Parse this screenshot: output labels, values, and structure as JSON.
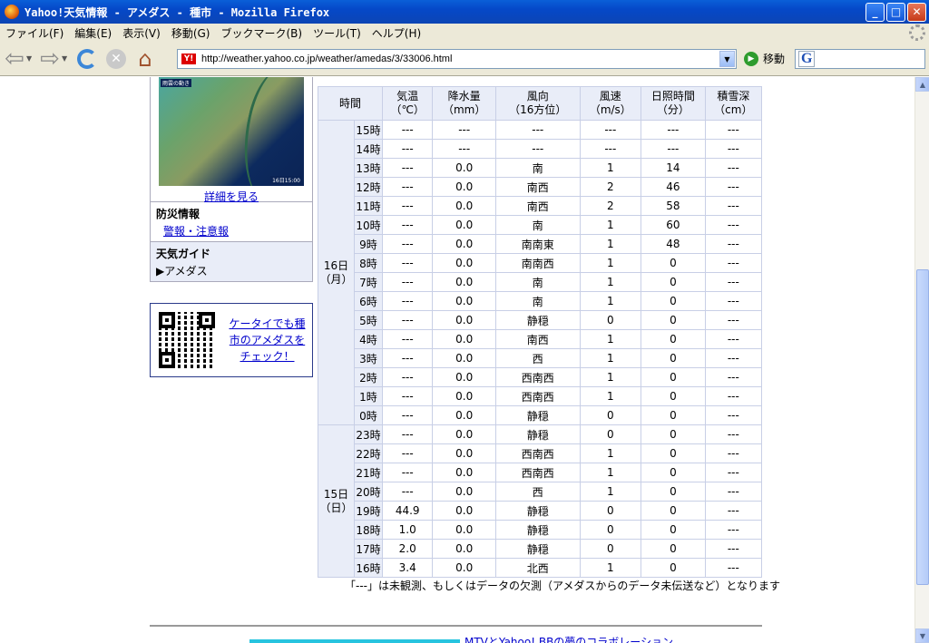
{
  "window": {
    "title": "Yahoo!天気情報 - アメダス - 種市 - Mozilla Firefox",
    "minimize": "_",
    "maximize": "□",
    "close": "✕"
  },
  "menu": [
    "ファイル(F)",
    "編集(E)",
    "表示(V)",
    "移動(G)",
    "ブックマーク(B)",
    "ツール(T)",
    "ヘルプ(H)"
  ],
  "toolbar": {
    "url": "http://weather.yahoo.co.jp/weather/amedas/3/33006.html",
    "go_label": "移動",
    "favicon": "Y!",
    "search_logo": "G"
  },
  "sidebar": {
    "map_caption": "雨雲の動き",
    "map_time": "16日15:00",
    "detail_link": "詳細を見る",
    "disaster": {
      "heading": "防災情報",
      "link": "警報・注意報"
    },
    "guide": {
      "heading": "天気ガイド",
      "item": "▶アメダス"
    },
    "mobile_promo": "ケータイでも種市のアメダスをチェック！"
  },
  "table": {
    "headers": {
      "time": "時間",
      "temp": "気温\n（℃）",
      "precip": "降水量\n（mm）",
      "wind_dir": "風向\n（16方位）",
      "wind_speed": "風速\n（m/s）",
      "sunshine": "日照時間\n（分）",
      "snow": "積雪深\n（cm）"
    },
    "days": [
      {
        "label": "16日\n（月）",
        "rows": [
          {
            "hour": "15時",
            "temp": "---",
            "precip": "---",
            "dir": "---",
            "speed": "---",
            "sun": "---",
            "snow": "---"
          },
          {
            "hour": "14時",
            "temp": "---",
            "precip": "---",
            "dir": "---",
            "speed": "---",
            "sun": "---",
            "snow": "---"
          },
          {
            "hour": "13時",
            "temp": "---",
            "precip": "0.0",
            "dir": "南",
            "speed": "1",
            "sun": "14",
            "snow": "---"
          },
          {
            "hour": "12時",
            "temp": "---",
            "precip": "0.0",
            "dir": "南西",
            "speed": "2",
            "sun": "46",
            "snow": "---"
          },
          {
            "hour": "11時",
            "temp": "---",
            "precip": "0.0",
            "dir": "南西",
            "speed": "2",
            "sun": "58",
            "snow": "---"
          },
          {
            "hour": "10時",
            "temp": "---",
            "precip": "0.0",
            "dir": "南",
            "speed": "1",
            "sun": "60",
            "snow": "---"
          },
          {
            "hour": "9時",
            "temp": "---",
            "precip": "0.0",
            "dir": "南南東",
            "speed": "1",
            "sun": "48",
            "snow": "---"
          },
          {
            "hour": "8時",
            "temp": "---",
            "precip": "0.0",
            "dir": "南南西",
            "speed": "1",
            "sun": "0",
            "snow": "---"
          },
          {
            "hour": "7時",
            "temp": "---",
            "precip": "0.0",
            "dir": "南",
            "speed": "1",
            "sun": "0",
            "snow": "---"
          },
          {
            "hour": "6時",
            "temp": "---",
            "precip": "0.0",
            "dir": "南",
            "speed": "1",
            "sun": "0",
            "snow": "---"
          },
          {
            "hour": "5時",
            "temp": "---",
            "precip": "0.0",
            "dir": "静穏",
            "speed": "0",
            "sun": "0",
            "snow": "---"
          },
          {
            "hour": "4時",
            "temp": "---",
            "precip": "0.0",
            "dir": "南西",
            "speed": "1",
            "sun": "0",
            "snow": "---"
          },
          {
            "hour": "3時",
            "temp": "---",
            "precip": "0.0",
            "dir": "西",
            "speed": "1",
            "sun": "0",
            "snow": "---"
          },
          {
            "hour": "2時",
            "temp": "---",
            "precip": "0.0",
            "dir": "西南西",
            "speed": "1",
            "sun": "0",
            "snow": "---"
          },
          {
            "hour": "1時",
            "temp": "---",
            "precip": "0.0",
            "dir": "西南西",
            "speed": "1",
            "sun": "0",
            "snow": "---"
          },
          {
            "hour": "0時",
            "temp": "---",
            "precip": "0.0",
            "dir": "静穏",
            "speed": "0",
            "sun": "0",
            "snow": "---"
          }
        ]
      },
      {
        "label": "15日\n（日）",
        "rows": [
          {
            "hour": "23時",
            "temp": "---",
            "precip": "0.0",
            "dir": "静穏",
            "speed": "0",
            "sun": "0",
            "snow": "---"
          },
          {
            "hour": "22時",
            "temp": "---",
            "precip": "0.0",
            "dir": "西南西",
            "speed": "1",
            "sun": "0",
            "snow": "---"
          },
          {
            "hour": "21時",
            "temp": "---",
            "precip": "0.0",
            "dir": "西南西",
            "speed": "1",
            "sun": "0",
            "snow": "---"
          },
          {
            "hour": "20時",
            "temp": "---",
            "precip": "0.0",
            "dir": "西",
            "speed": "1",
            "sun": "0",
            "snow": "---"
          },
          {
            "hour": "19時",
            "temp": "44.9",
            "precip": "0.0",
            "dir": "静穏",
            "speed": "0",
            "sun": "0",
            "snow": "---"
          },
          {
            "hour": "18時",
            "temp": "1.0",
            "precip": "0.0",
            "dir": "静穏",
            "speed": "0",
            "sun": "0",
            "snow": "---"
          },
          {
            "hour": "17時",
            "temp": "2.0",
            "precip": "0.0",
            "dir": "静穏",
            "speed": "0",
            "sun": "0",
            "snow": "---"
          },
          {
            "hour": "16時",
            "temp": "3.4",
            "precip": "0.0",
            "dir": "北西",
            "speed": "1",
            "sun": "0",
            "snow": "---"
          }
        ]
      }
    ]
  },
  "note": "「---」は未観測、もしくはデータの欠測（アメダスからのデータ未伝送など）となります",
  "footer_banner": "MTVとYahoo! BBの夢のコラボレーション"
}
